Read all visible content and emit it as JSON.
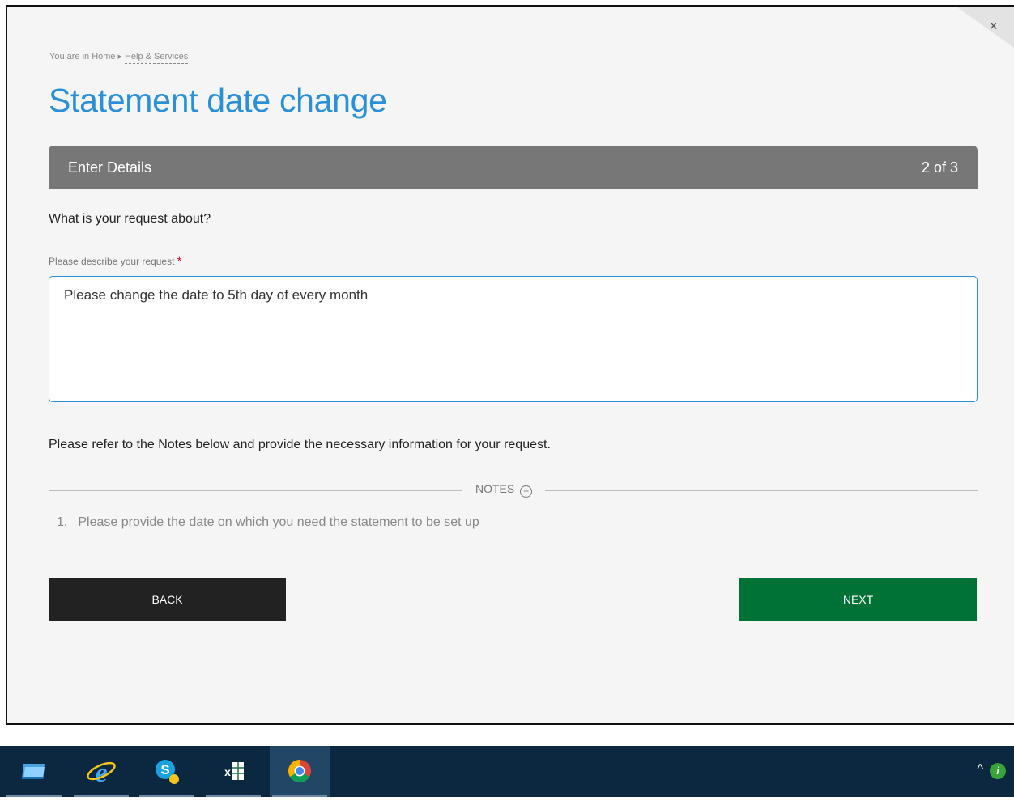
{
  "dialog": {
    "close_label": "×",
    "breadcrumb": {
      "prefix": "You are in Home",
      "link": "Help & Services"
    },
    "title": "Statement date change",
    "step": {
      "label": "Enter Details",
      "count": "2 of 3"
    },
    "question": "What is your request about?",
    "field": {
      "label": "Please describe your request",
      "required_mark": "*",
      "value": "Please change the date to 5th day of every month"
    },
    "refer_text": "Please refer to the Notes below and provide the necessary information for your request.",
    "notes": {
      "header": "NOTES",
      "toggle_icon": "minus-circle-icon",
      "items": [
        {
          "num": "1.",
          "text": "Please provide the date on which you need the statement to be set up"
        }
      ]
    },
    "buttons": {
      "back": "BACK",
      "next": "NEXT"
    },
    "colors": {
      "title": "#2a90d8",
      "next": "#007236",
      "back": "#222222",
      "stepbar": "#777777"
    }
  },
  "taskbar": {
    "apps": [
      {
        "name": "explorer-icon"
      },
      {
        "name": "internet-explorer-icon"
      },
      {
        "name": "skype-icon"
      },
      {
        "name": "excel-icon",
        "glyph": "x"
      },
      {
        "name": "chrome-icon",
        "active": true
      }
    ],
    "tray": {
      "chevron": "^",
      "info_glyph": "i"
    }
  }
}
